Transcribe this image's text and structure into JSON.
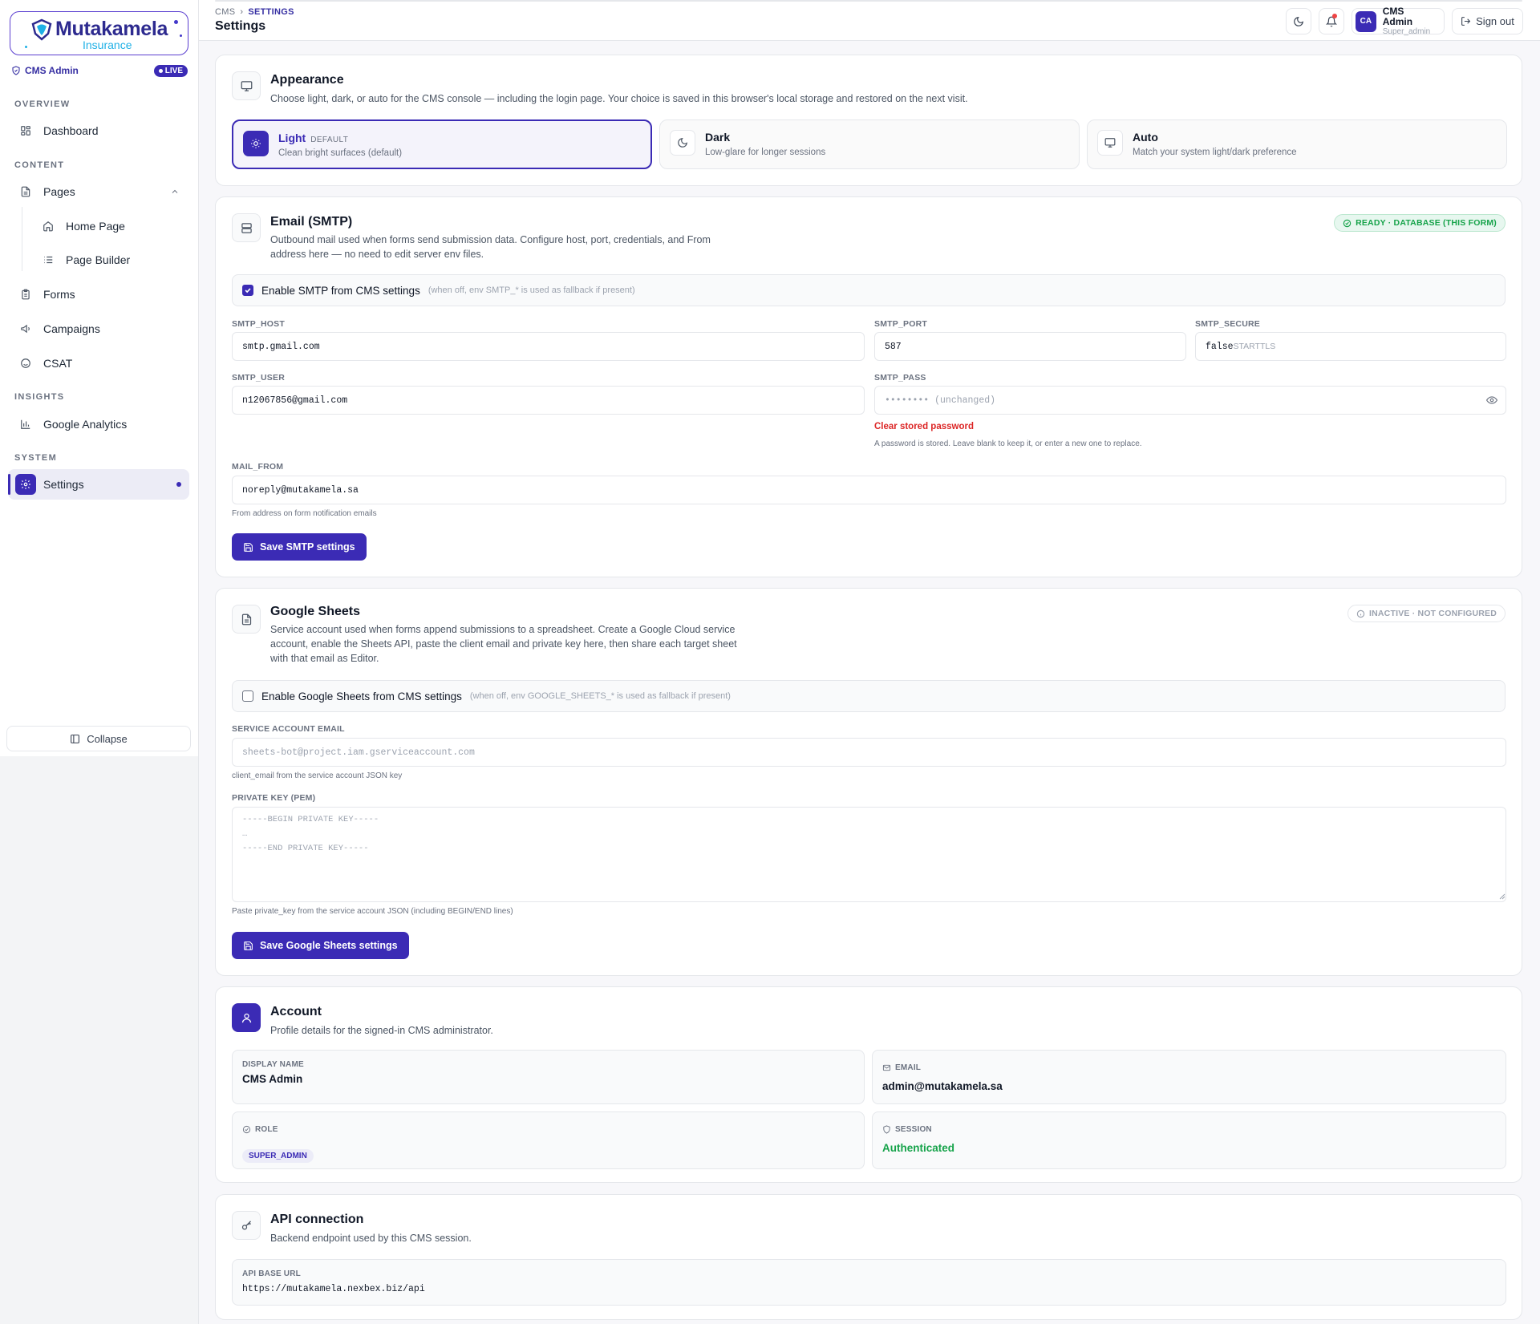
{
  "brand": {
    "name": "Mutakamela",
    "sub": "Insurance",
    "admin_label": "CMS Admin",
    "live": "LIVE",
    "accent": "#3b2bb5"
  },
  "sidebar": {
    "sections": [
      "OVERVIEW",
      "CONTENT",
      "INSIGHTS",
      "SYSTEM"
    ],
    "items": [
      {
        "label": "Dashboard",
        "icon": "grid-icon"
      },
      {
        "label": "Pages",
        "icon": "file-icon"
      },
      {
        "label": "Home Page",
        "icon": "home-icon"
      },
      {
        "label": "Page Builder",
        "icon": "list-icon"
      },
      {
        "label": "Forms",
        "icon": "clipboard-icon"
      },
      {
        "label": "Campaigns",
        "icon": "megaphone-icon"
      },
      {
        "label": "CSAT",
        "icon": "smile-icon"
      },
      {
        "label": "Google Analytics",
        "icon": "bar-chart-icon"
      },
      {
        "label": "Settings",
        "icon": "gear-icon"
      }
    ],
    "collapse": "Collapse"
  },
  "topbar": {
    "crumb_root": "CMS",
    "crumb_current": "SETTINGS",
    "title": "Settings",
    "user_initials": "CA",
    "user_name": "CMS Admin",
    "user_role": "Super_admin",
    "signout": "Sign out"
  },
  "appearance": {
    "title": "Appearance",
    "desc": "Choose light, dark, or auto for the CMS console — including the login page. Your choice is saved in this browser's local storage and restored on the next visit.",
    "options": [
      {
        "name": "Light",
        "tag": "DEFAULT",
        "desc": "Clean bright surfaces (default)"
      },
      {
        "name": "Dark",
        "tag": "",
        "desc": "Low-glare for longer sessions"
      },
      {
        "name": "Auto",
        "tag": "",
        "desc": "Match your system light/dark preference"
      }
    ]
  },
  "smtp": {
    "title": "Email (SMTP)",
    "desc1": "Outbound mail used when forms send submission data. Configure host, port, credentials, and From",
    "desc2": "address here — no need to edit server env files.",
    "status": "READY · DATABASE (THIS FORM)",
    "enable_label": "Enable SMTP from CMS settings",
    "enable_hint": "(when off, env SMTP_* is used as fallback if present)",
    "host_label": "SMTP_HOST",
    "host_value": "smtp.gmail.com",
    "port_label": "SMTP_PORT",
    "port_value": "587",
    "secure_label": "SMTP_SECURE",
    "secure_value": "false",
    "secure_note": "STARTTLS",
    "user_label": "SMTP_USER",
    "user_value": "n12067856@gmail.com",
    "pass_label": "SMTP_PASS",
    "pass_placeholder": "•••••••• (unchanged)",
    "clear_pass": "Clear stored password",
    "pass_hint": "A password is stored. Leave blank to keep it, or enter a new one to replace.",
    "from_label": "MAIL_FROM",
    "from_value": "noreply@mutakamela.sa",
    "from_hint": "From address on form notification emails",
    "save": "Save SMTP settings"
  },
  "sheets": {
    "title": "Google Sheets",
    "desc1": "Service account used when forms append submissions to a spreadsheet. Create a Google Cloud service",
    "desc2": "account, enable the Sheets API, paste the client email and private key here, then share each target sheet",
    "desc3": "with that email as Editor.",
    "status": "INACTIVE · NOT CONFIGURED",
    "enable_label": "Enable Google Sheets from CMS settings",
    "enable_hint": "(when off, env GOOGLE_SHEETS_* is used as fallback if present)",
    "email_label": "SERVICE ACCOUNT EMAIL",
    "email_placeholder": "sheets-bot@project.iam.gserviceaccount.com",
    "email_hint": "client_email from the service account JSON key",
    "key_label": "PRIVATE KEY (PEM)",
    "key_placeholder": "-----BEGIN PRIVATE KEY-----\n…\n-----END PRIVATE KEY-----",
    "key_hint": "Paste private_key from the service account JSON (including BEGIN/END lines)",
    "save": "Save Google Sheets settings"
  },
  "account": {
    "title": "Account",
    "desc": "Profile details for the signed-in CMS administrator.",
    "display_label": "DISPLAY NAME",
    "display_value": "CMS Admin",
    "email_label": "EMAIL",
    "email_value": "admin@mutakamela.sa",
    "role_label": "ROLE",
    "role_value": "SUPER_ADMIN",
    "session_label": "SESSION",
    "session_value": "Authenticated"
  },
  "api": {
    "title": "API connection",
    "desc": "Backend endpoint used by this CMS session.",
    "label": "API BASE URL",
    "value": "https://mutakamela.nexbex.biz/api"
  }
}
